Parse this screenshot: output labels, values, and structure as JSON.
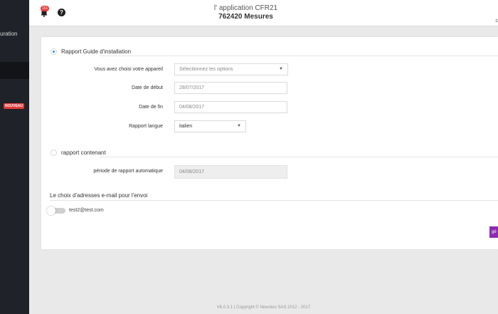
{
  "sidebar": {
    "partial_text": "uration",
    "nouveau_badge": "NOUVEAU"
  },
  "header": {
    "notification_count": "151",
    "app_title": "l' application CFR21",
    "app_subtitle": "762420 Mesures",
    "corner_text": "c"
  },
  "report_guide": {
    "label": "Rapport Guide d'installation",
    "device_label": "Vous avez choisi votre appareil",
    "device_placeholder": "Sélectionnez les options",
    "start_label": "Date de début",
    "start_value": "28/07/2017",
    "end_label": "Date de fin",
    "end_value": "04/08/2017",
    "lang_label": "Rapport langue",
    "lang_value": "italien"
  },
  "report_content": {
    "label": "rapport contenant",
    "period_label": "période de rapport automatique",
    "period_value": "04/08/2017"
  },
  "email": {
    "title": "Le choix d'adresses e-mail pour l'envoi",
    "address": "test2@test.com"
  },
  "actions": {
    "generate_partial": "gé"
  },
  "footer": "V6.0.3.1 | Copyright © Newsteo SAS 2012 - 2017",
  "colors": {
    "sidebar": "#1f2228",
    "accent_radio": "#2f8fe0",
    "badge_red": "#e23b3b",
    "generate_button": "#8e2ab0"
  }
}
